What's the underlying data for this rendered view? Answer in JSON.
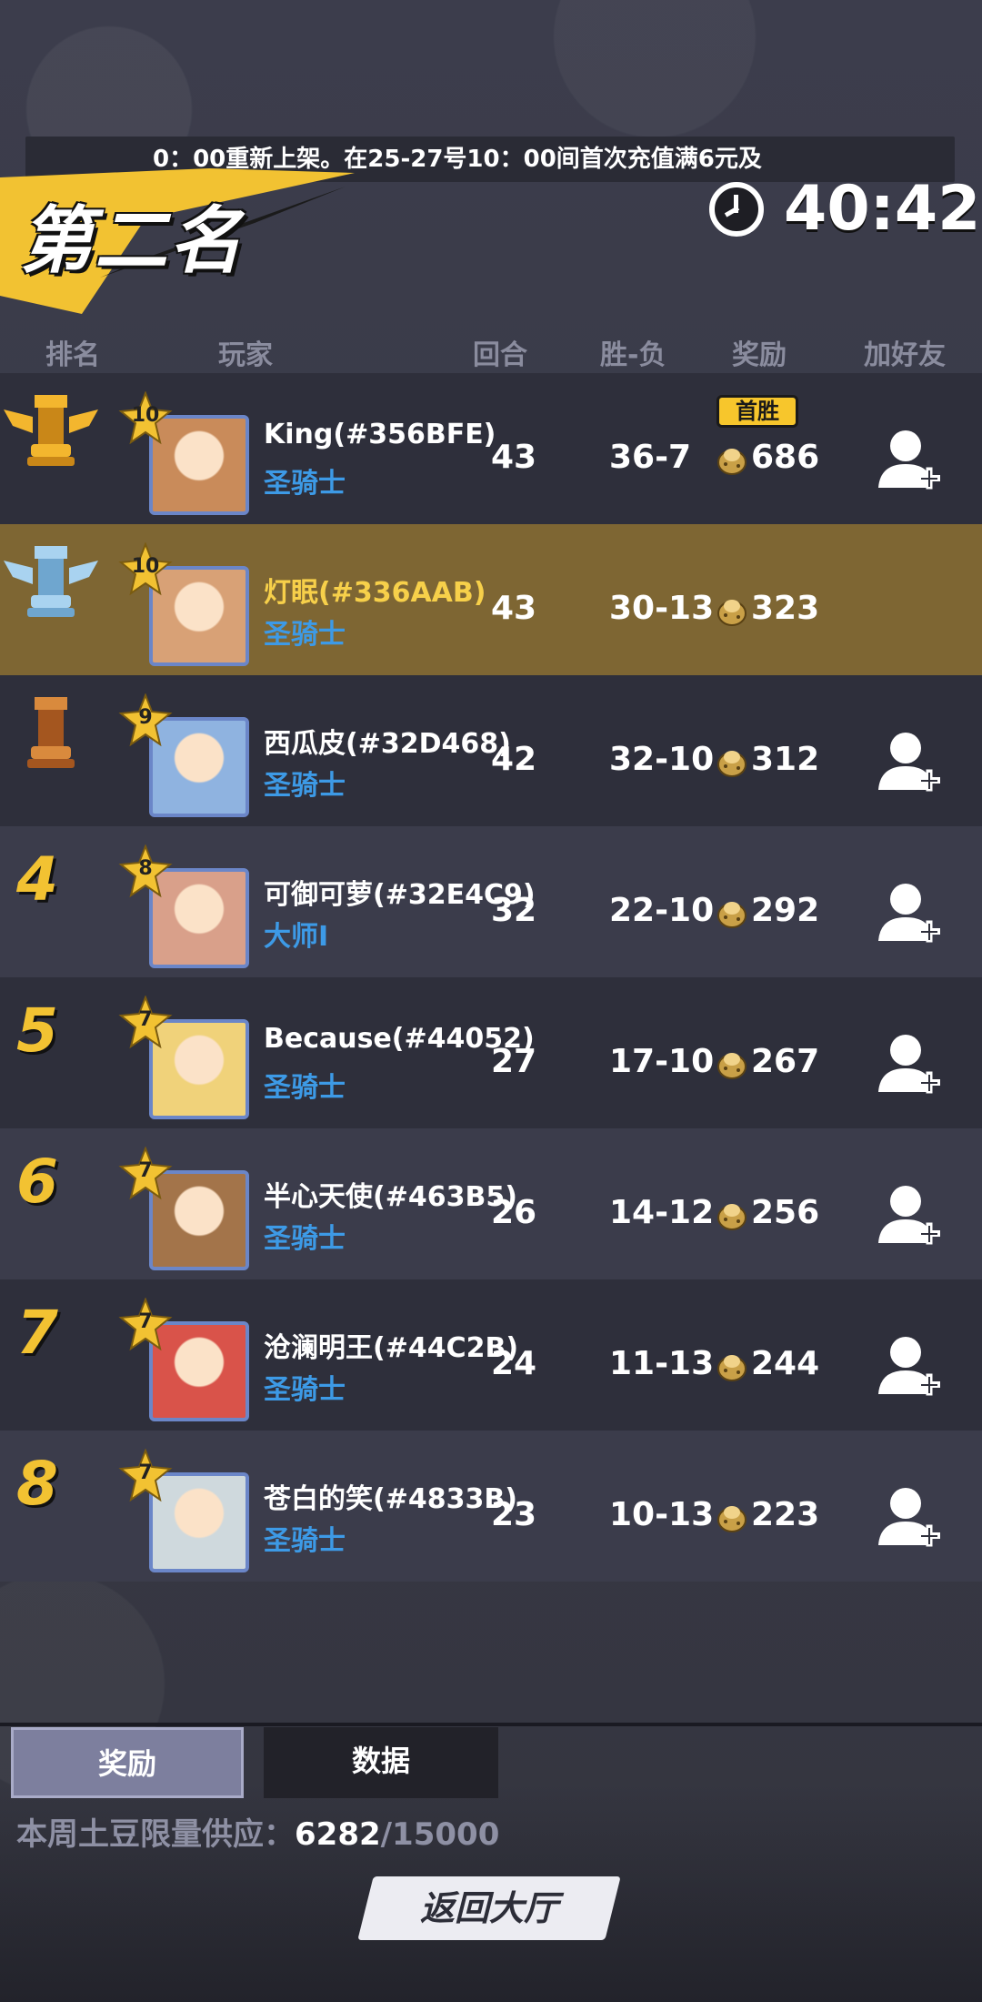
{
  "ticker": {
    "text": "0：00重新上架。在25-27号10：00间首次充值满6元及"
  },
  "banner": {
    "title": "第二名"
  },
  "timer": {
    "value": "40:42"
  },
  "headers": {
    "rank": "排名",
    "player": "玩家",
    "rounds": "回合",
    "winloss": "胜-负",
    "reward": "奖励",
    "add": "加好友"
  },
  "rows": [
    {
      "rank": "",
      "trophy": "gold",
      "level": "10",
      "name": "King(#356BFE)",
      "title": "圣骑士",
      "rounds": "43",
      "wl": "36-7",
      "reward": "686",
      "badge": "首胜",
      "friend": true,
      "avatar_color": "#c98b5a"
    },
    {
      "rank": "",
      "trophy": "silver",
      "level": "10",
      "name": "灯眠(#336AAB)",
      "title": "圣骑士",
      "rounds": "43",
      "wl": "30-13",
      "reward": "323",
      "friend": false,
      "avatar_color": "#d8a176",
      "me": true
    },
    {
      "rank": "",
      "trophy": "bronze",
      "level": "9",
      "name": "西瓜皮(#32D468)",
      "title": "圣骑士",
      "rounds": "42",
      "wl": "32-10",
      "reward": "312",
      "friend": true,
      "avatar_color": "#8fb3e0"
    },
    {
      "rank": "4",
      "level": "8",
      "name": "可御可萝(#32E4C9)",
      "title": "大师I",
      "rounds": "32",
      "wl": "22-10",
      "reward": "292",
      "friend": true,
      "avatar_color": "#d9a08a"
    },
    {
      "rank": "5",
      "level": "7",
      "name": "Because(#44052)",
      "title": "圣骑士",
      "rounds": "27",
      "wl": "17-10",
      "reward": "267",
      "friend": true,
      "avatar_color": "#f0d27a"
    },
    {
      "rank": "6",
      "level": "7",
      "name": "半心天使(#463B5)",
      "title": "圣骑士",
      "rounds": "26",
      "wl": "14-12",
      "reward": "256",
      "friend": true,
      "avatar_color": "#a3744a"
    },
    {
      "rank": "7",
      "level": "7",
      "name": "沧澜明王(#44C2B)",
      "title": "圣骑士",
      "rounds": "24",
      "wl": "11-13",
      "reward": "244",
      "friend": true,
      "avatar_color": "#d9534a"
    },
    {
      "rank": "8",
      "level": "7",
      "name": "苍白的笑(#4833B)",
      "title": "圣骑士",
      "rounds": "23",
      "wl": "10-13",
      "reward": "223",
      "friend": true,
      "avatar_color": "#cfd9dd"
    }
  ],
  "tabs": {
    "reward": "奖励",
    "data": "数据"
  },
  "supply": {
    "label": "本周土豆限量供应：",
    "current": "6282",
    "max": "/15000"
  },
  "back_button": "返回大厅",
  "colors": {
    "gold_rank": "#f2c232",
    "title_blue": "#3d9ae6",
    "highlight_row": "#7e6633"
  }
}
